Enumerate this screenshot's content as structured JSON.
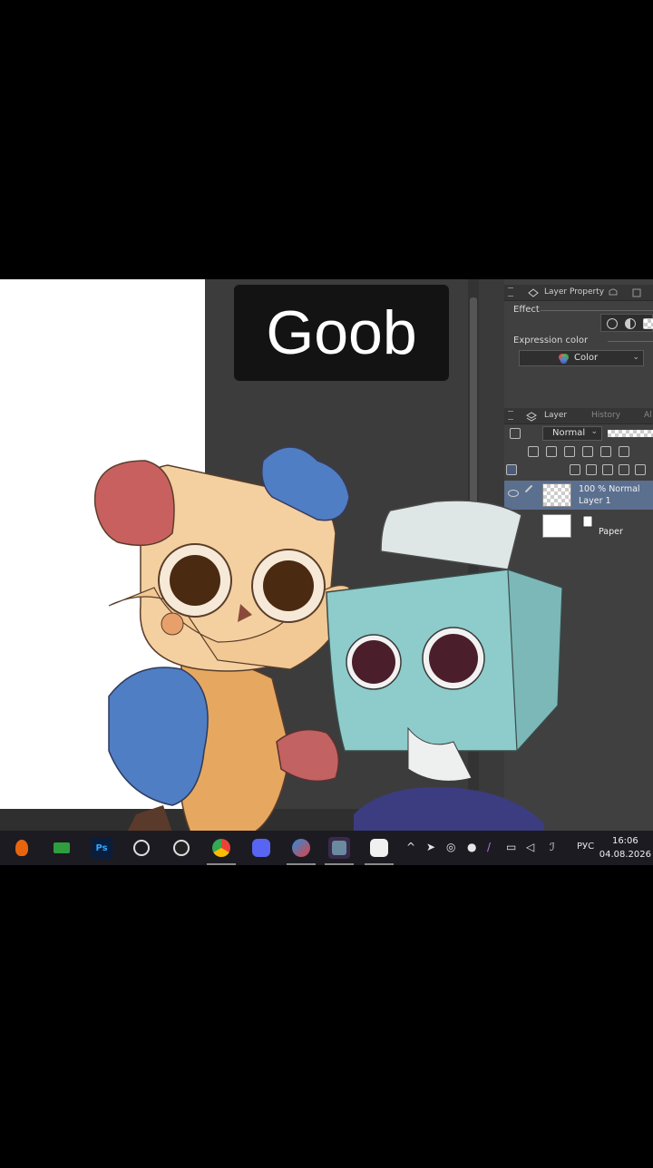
{
  "video": {
    "title": "Goob"
  },
  "panels": {
    "layer_property": {
      "tab_label": "Layer Property",
      "effect_label": "Effect",
      "expression_color_label": "Expression color",
      "color_dropdown_value": "Color"
    },
    "layer": {
      "tab_label": "Layer",
      "history_tab_label": "History",
      "extra_tab_label": "Al",
      "blend_mode": "Normal",
      "layers": [
        {
          "opacity_mode": "100 % Normal",
          "name": "Layer 1",
          "selected": true
        },
        {
          "name": "Paper",
          "selected": false
        }
      ]
    }
  },
  "taskbar": {
    "apps": [
      {
        "name": "fl-studio-icon",
        "label": "",
        "color": "#e8650f"
      },
      {
        "name": "green-app-icon",
        "label": "",
        "color": "#2e9e3e"
      },
      {
        "name": "photoshop-icon",
        "label": "Ps",
        "color": "#0a1e3c"
      },
      {
        "name": "obs-like-icon",
        "label": "",
        "color": "#1c1b22"
      },
      {
        "name": "obs-icon",
        "label": "",
        "color": "#1c1b22"
      },
      {
        "name": "chrome-icon",
        "label": "",
        "color": "#1c1b22"
      },
      {
        "name": "discord-icon",
        "label": "",
        "color": "#5865f2"
      },
      {
        "name": "edge-like-icon",
        "label": "",
        "color": "#1c1b22"
      },
      {
        "name": "game-icon",
        "label": "",
        "color": "#4a3a6a"
      },
      {
        "name": "clip-studio-icon",
        "label": "",
        "color": "#f0f0f0"
      }
    ],
    "language": "РУС",
    "time": "16:06",
    "date": "04.08.2026"
  }
}
